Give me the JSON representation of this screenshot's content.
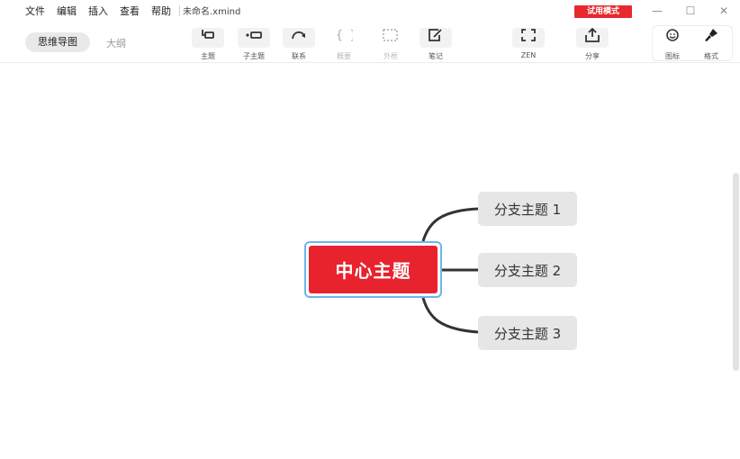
{
  "menu": {
    "items": [
      "文件",
      "编辑",
      "插入",
      "查看",
      "帮助"
    ],
    "file_title": "未命名.xmind",
    "trial_badge": "试用模式"
  },
  "window_controls": {
    "minimize": "—",
    "maximize": "☐",
    "close": "✕"
  },
  "view_modes": {
    "mindmap": "思维导图",
    "outline": "大纲"
  },
  "toolbar": {
    "topic": "主题",
    "subtopic": "子主题",
    "relationship": "联系",
    "summary": "概要",
    "boundary": "外框",
    "notes": "笔记",
    "zen": "ZEN",
    "share": "分享",
    "icon": "图标",
    "format": "格式"
  },
  "mindmap": {
    "central_topic": "中心主题",
    "branches": [
      "分支主题 1",
      "分支主题 2",
      "分支主题 3"
    ]
  },
  "colors": {
    "central_fill": "#e8232e",
    "selection_border": "#6cb6ea",
    "branch_fill": "#e6e6e6",
    "trial_badge": "#e8282e"
  }
}
